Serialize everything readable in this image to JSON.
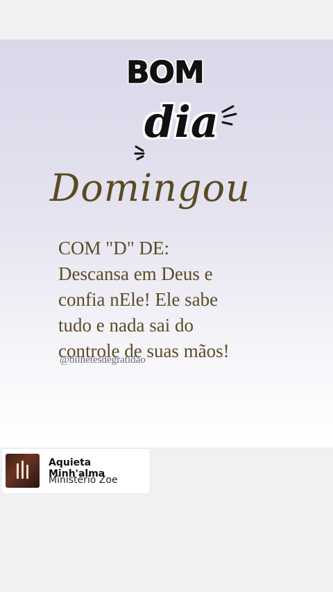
{
  "post": {
    "greeting_line1": "BOM",
    "greeting_line2": "dia",
    "title": "Domingou",
    "body_lines": [
      "COM \"D\" DE:",
      "Descansa em Deus e",
      "confia nEle! Ele sabe",
      "tudo e nada sai do",
      "controle de suas mãos!"
    ],
    "handle": "@bilhetesdegratidao"
  },
  "music": {
    "title": "Aquieta Minh'alma",
    "artist": "Ministério Zoe",
    "icon": "album-art"
  },
  "colors": {
    "gold_text": "#5a4c26",
    "background": "#f1f0f2"
  }
}
